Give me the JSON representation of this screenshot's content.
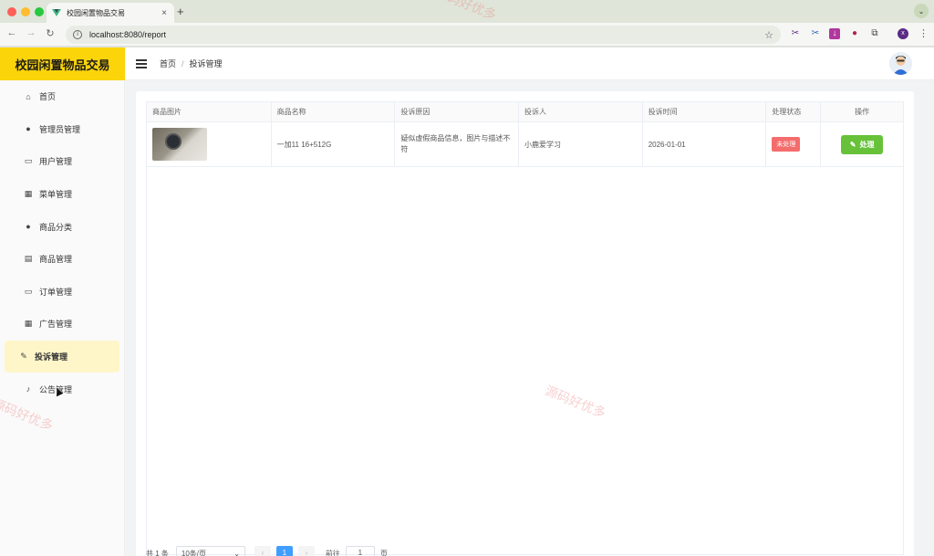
{
  "browser": {
    "tab_title": "校园闲置物品交易",
    "tab_close": "×",
    "new_tab": "+",
    "url": "localhost:8080/report",
    "profile_initial": "x"
  },
  "app": {
    "logo": "校园闲置物品交易",
    "accent_color": "#fbd40a"
  },
  "sidebar": {
    "items": [
      {
        "label": "首页",
        "icon": "home-icon"
      },
      {
        "label": "管理员管理",
        "icon": "user-icon"
      },
      {
        "label": "用户管理",
        "icon": "folder-icon"
      },
      {
        "label": "菜单管理",
        "icon": "grid-icon"
      },
      {
        "label": "商品分类",
        "icon": "user-icon"
      },
      {
        "label": "商品管理",
        "icon": "document-icon"
      },
      {
        "label": "订单管理",
        "icon": "monitor-icon"
      },
      {
        "label": "广告管理",
        "icon": "calendar-icon"
      },
      {
        "label": "投诉管理",
        "icon": "edit-icon",
        "active": true
      },
      {
        "label": "公告管理",
        "icon": "bell-icon"
      }
    ]
  },
  "header": {
    "breadcrumb_home": "首页",
    "breadcrumb_sep": "/",
    "breadcrumb_current": "投诉管理"
  },
  "table": {
    "columns": [
      "商品图片",
      "商品名称",
      "投诉原因",
      "投诉人",
      "投诉时间",
      "处理状态",
      "操作"
    ],
    "rows": [
      {
        "name": "一加11 16+512G",
        "reason": "疑似虚假商品信息，图片与描述不符",
        "reporter": "小鹿爱学习",
        "time": "2026-01-01",
        "status": "未处理",
        "action": "处理"
      }
    ]
  },
  "pagination": {
    "total": "共 1 条",
    "page_size": "10条/页",
    "current_page": "1",
    "goto_label": "前往",
    "goto_value": "1",
    "page_suffix": "页"
  },
  "watermark": "源码好优多"
}
